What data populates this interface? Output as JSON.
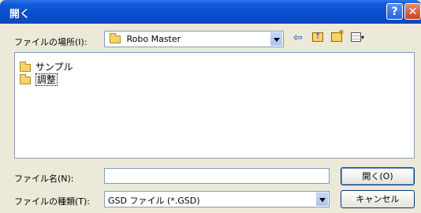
{
  "window": {
    "title": "開く"
  },
  "titlebar": {
    "help_glyph": "?",
    "close_glyph": "✕"
  },
  "look_in": {
    "label": "ファイルの場所(I):",
    "value": "Robo Master"
  },
  "toolbar": {
    "icons": [
      "back-arrow-icon",
      "up-folder-icon",
      "new-folder-icon",
      "view-menu-icon"
    ]
  },
  "file_list": {
    "items": [
      {
        "name": "サンプル",
        "icon": "folder-icon"
      },
      {
        "name": "調整",
        "icon": "folder-icon"
      }
    ]
  },
  "file_name": {
    "label": "ファイル名(N):",
    "value": ""
  },
  "file_type": {
    "label": "ファイルの種類(T):",
    "value": "GSD ファイル (*.GSD)"
  },
  "buttons": {
    "open": "開く(O)",
    "cancel": "キャンセル"
  },
  "colors": {
    "titlebar": "#0a4fd0",
    "dialog_bg": "#ece9d8",
    "close_button": "#c8431f"
  }
}
